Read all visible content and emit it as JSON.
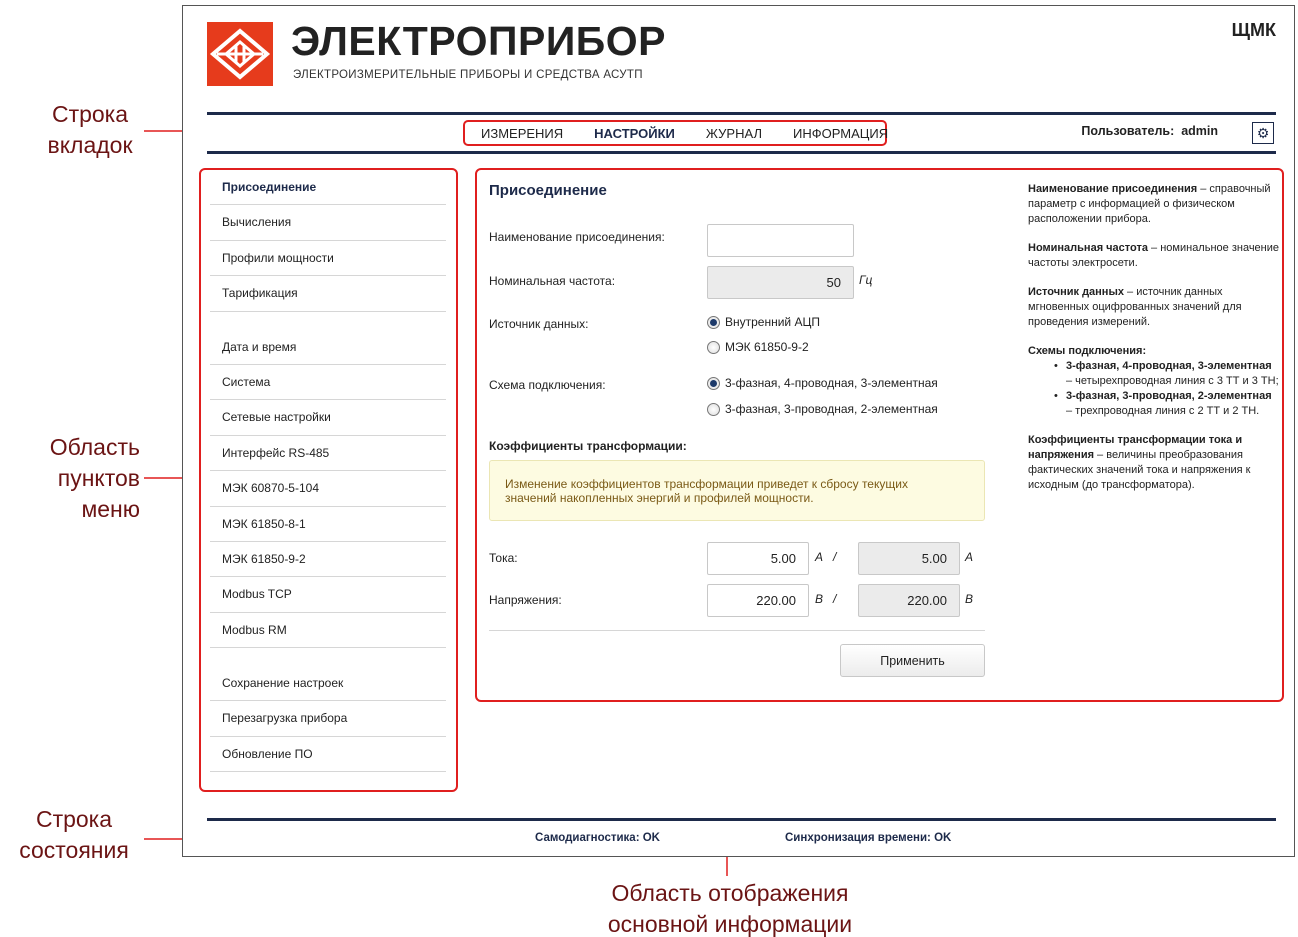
{
  "brand": {
    "title": "ЭЛЕКТРОПРИБОР",
    "subtitle": "ЭЛЕКТРОИЗМЕРИТЕЛЬНЫЕ ПРИБОРЫ И СРЕДСТВА АСУТП",
    "corner": "ЩМК"
  },
  "tabs": [
    {
      "label": "ИЗМЕРЕНИЯ"
    },
    {
      "label": "НАСТРОЙКИ"
    },
    {
      "label": "ЖУРНАЛ"
    },
    {
      "label": "ИНФОРМАЦИЯ"
    }
  ],
  "user": {
    "label": "Пользователь:",
    "name": "admin"
  },
  "menu": [
    {
      "label": "Присоединение"
    },
    {
      "label": "Вычисления"
    },
    {
      "label": "Профили мощности"
    },
    {
      "label": "Тарификация"
    },
    {
      "label": "Дата и время"
    },
    {
      "label": "Система"
    },
    {
      "label": "Сетевые настройки"
    },
    {
      "label": "Интерфейс RS-485"
    },
    {
      "label": "МЭК 60870-5-104"
    },
    {
      "label": "МЭК 61850-8-1"
    },
    {
      "label": "МЭК 61850-9-2"
    },
    {
      "label": "Modbus TCP"
    },
    {
      "label": "Modbus RM"
    },
    {
      "label": "Сохранение настроек"
    },
    {
      "label": "Перезагрузка прибора"
    },
    {
      "label": "Обновление ПО"
    }
  ],
  "form": {
    "title": "Присоединение",
    "name_label": "Наименование присоединения:",
    "name_value": "",
    "freq_label": "Номинальная частота:",
    "freq_value": "50",
    "freq_unit": "Гц",
    "source_label": "Источник данных:",
    "source_options": [
      "Внутренний АЦП",
      "МЭК 61850-9-2"
    ],
    "scheme_label": "Схема подключения:",
    "scheme_options": [
      "3-фазная, 4-проводная, 3-элементная",
      "3-фазная, 3-проводная, 2-элементная"
    ],
    "coef_label": "Коэффициенты трансформации:",
    "warning_line1": "Изменение коэффициентов трансформации приведет к сбросу текущих",
    "warning_line2": "значений накопленных энергий и профилей мощности.",
    "current_label": "Тока:",
    "current_primary": "5.00",
    "current_secondary": "5.00",
    "current_unit": "А",
    "voltage_label": "Напряжения:",
    "voltage_primary": "220.00",
    "voltage_secondary": "220.00",
    "voltage_unit": "В",
    "slash": "/",
    "apply_label": "Применить"
  },
  "help": {
    "name_term": "Наименование присоединения",
    "name_desc": " – справочный параметр с информацией о физическом расположении прибора.",
    "freq_term": "Номинальная частота",
    "freq_desc": " – номинальное значение частоты электросети.",
    "source_term": "Источник данных",
    "source_desc": " – источник данных мгновенных оцифрованных значений для проведения измерений.",
    "scheme_term": "Схемы подключения:",
    "scheme1_term": "3-фазная, 4-проводная, 3-элементная",
    "scheme1_desc": " – четырехпроводная линия с 3 ТТ и 3 ТН;",
    "scheme2_term": "3-фазная, 3-проводная, 2-элементная",
    "scheme2_desc": " – трехпроводная линия с 2 ТТ и 2 ТН.",
    "coef_term": "Коэффициенты трансформации тока и напряжения",
    "coef_desc": " – величины преобразования фактических значений тока и напряжения к исходным (до трансформатора)."
  },
  "status": {
    "diag_label": "Самодиагностика:",
    "diag_value": "OK",
    "sync_label": "Синхронизация времени:",
    "sync_value": "OK"
  },
  "annotations": {
    "tabs_line1": "Строка",
    "tabs_line2": "вкладок",
    "menu_line1": "Область",
    "menu_line2": "пунктов",
    "menu_line3": "меню",
    "status_line1": "Строка",
    "status_line2": "состояния",
    "main_line1": "Область отображения",
    "main_line2": "основной информации"
  },
  "colors": {
    "accent": "#e01f1f",
    "navy": "#1d2a4a",
    "logo": "#e63b1c",
    "annotation": "#6b1414"
  }
}
